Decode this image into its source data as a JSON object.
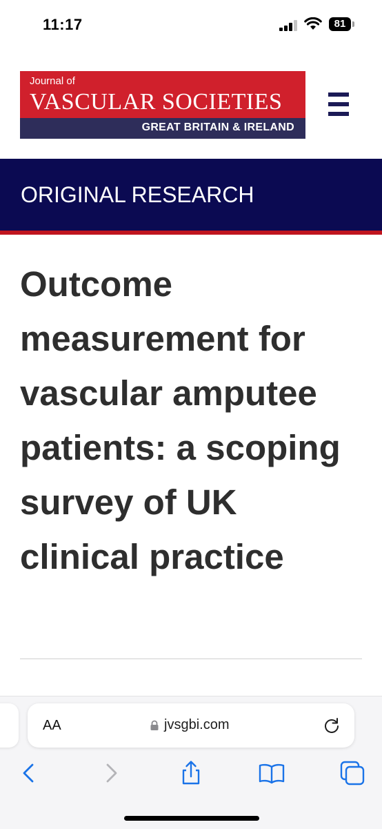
{
  "status_bar": {
    "time": "11:17",
    "battery": "81"
  },
  "header": {
    "logo_line1": "Journal of",
    "logo_line2": "VASCULAR SOCIETIES",
    "logo_line3": "GREAT BRITAIN & IRELAND",
    "colors": {
      "logo_red": "#d0202c",
      "logo_navy": "#2e2d5a",
      "menu_navy": "#1b1a56"
    }
  },
  "banner": {
    "label": "ORIGINAL RESEARCH",
    "colors": {
      "background": "#0b0a52",
      "underline": "#c0151f"
    }
  },
  "article": {
    "title": "Outcome measurement for vascular amputee patients: a scoping survey of UK clinical practice"
  },
  "browser": {
    "text_size_label": "AA",
    "url": "jvsgbi.com",
    "icons": [
      "back-icon",
      "forward-icon",
      "share-icon",
      "bookmarks-icon",
      "tabs-icon",
      "lock-icon",
      "reload-icon"
    ]
  }
}
